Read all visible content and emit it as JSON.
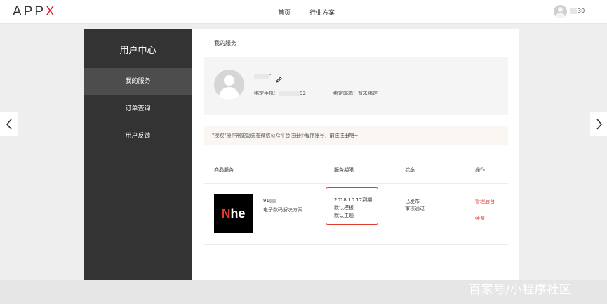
{
  "header": {
    "logo_prefix": "APP",
    "logo_x": "X",
    "nav_home": "首页",
    "nav_solutions": "行业方案",
    "username_suffix": "30"
  },
  "sidebar": {
    "title": "用户中心",
    "items": [
      {
        "label": "我的服务",
        "active": true
      },
      {
        "label": "订单查询",
        "active": false
      },
      {
        "label": "用户反馈",
        "active": false
      }
    ]
  },
  "main": {
    "section_title": "我的服务",
    "profile": {
      "name_suffix": "'",
      "phone_label": "绑定手机：",
      "phone_suffix": "92",
      "email_label": "绑定邮箱：",
      "email_value": "暂未绑定"
    },
    "notice": {
      "text": "\"授权\"操作需要您先在微信公众平台注册小程序账号，",
      "link": "前往注册",
      "tail": "吧~"
    },
    "table": {
      "headers": [
        "商品服务",
        "服务期限",
        "状态",
        "操作"
      ],
      "rows": [
        {
          "thumb_n": "N",
          "thumb_rest": "he",
          "name_prefix": "91",
          "desc": "电子数码解决方案",
          "period": [
            "2018.10.17到期",
            "默认模板",
            "默认主题"
          ],
          "status": "已发布",
          "review": "审核通过",
          "actions": [
            "管理后台",
            "续费"
          ]
        }
      ]
    }
  },
  "footer": {
    "watermark": "百家号/小程序社区"
  },
  "colors": {
    "accent": "#e23b2e",
    "sidebar_bg": "#333333",
    "sidebar_active": "#4d4d4d"
  }
}
